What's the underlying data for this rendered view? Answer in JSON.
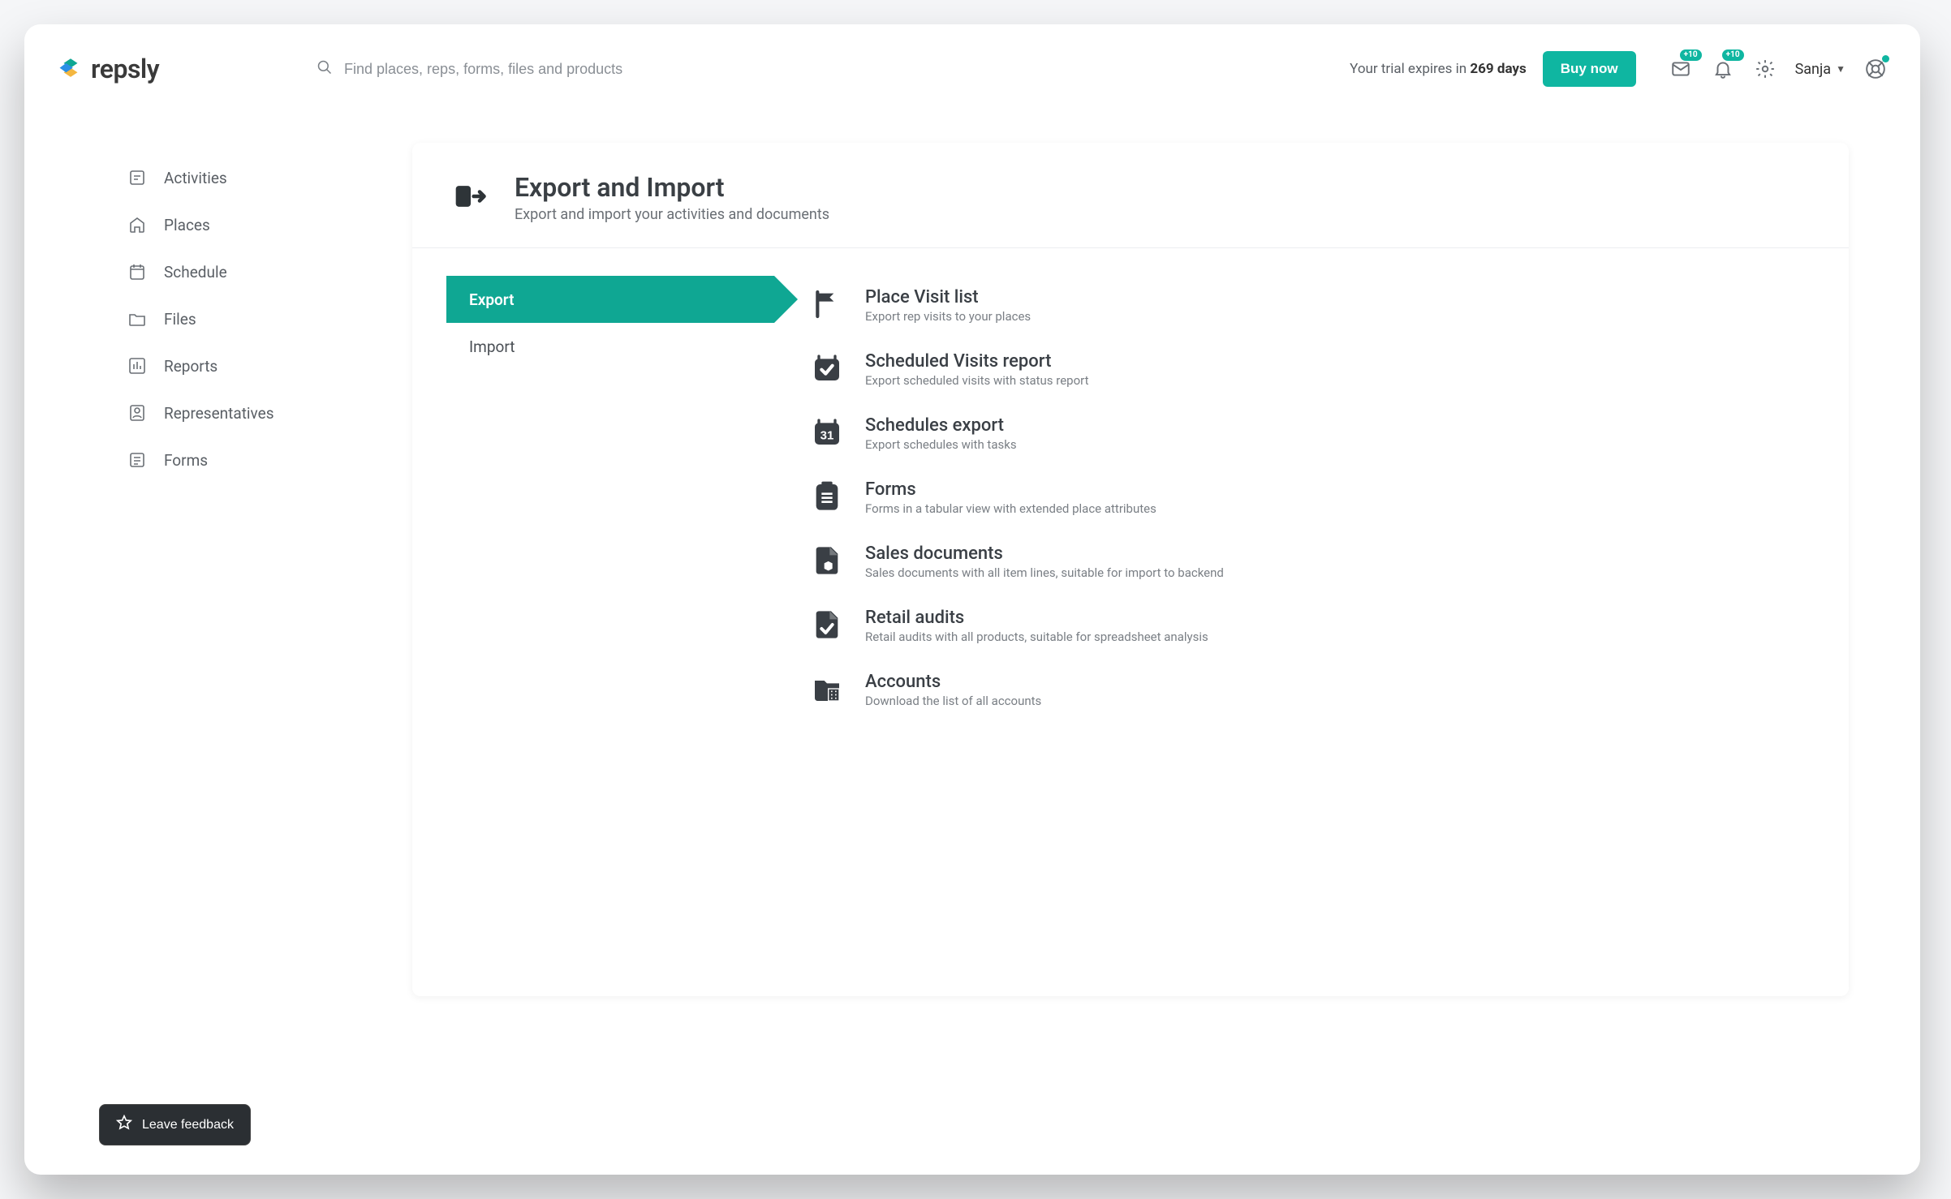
{
  "brand": {
    "name": "repsly"
  },
  "search": {
    "placeholder": "Find places, reps, forms, files and products"
  },
  "trial": {
    "prefix": "Your trial expires in ",
    "days": "269 days"
  },
  "buy": {
    "label": "Buy now"
  },
  "notifications": {
    "inbox_badge": "+10",
    "bell_badge": "+10"
  },
  "user": {
    "name": "Sanja"
  },
  "sidebar": {
    "items": [
      {
        "label": "Activities"
      },
      {
        "label": "Places"
      },
      {
        "label": "Schedule"
      },
      {
        "label": "Files"
      },
      {
        "label": "Reports"
      },
      {
        "label": "Representatives"
      },
      {
        "label": "Forms"
      }
    ]
  },
  "page": {
    "title": "Export and Import",
    "subtitle": "Export and import your activities and documents",
    "tabs": [
      {
        "label": "Export",
        "active": true
      },
      {
        "label": "Import",
        "active": false
      }
    ],
    "options": [
      {
        "title": "Place Visit list",
        "desc": "Export rep visits to your places"
      },
      {
        "title": "Scheduled Visits report",
        "desc": "Export scheduled visits with status report"
      },
      {
        "title": "Schedules export",
        "desc": "Export schedules with tasks"
      },
      {
        "title": "Forms",
        "desc": "Forms in a tabular view with extended place attributes"
      },
      {
        "title": "Sales documents",
        "desc": "Sales documents with all item lines, suitable for import to backend"
      },
      {
        "title": "Retail audits",
        "desc": "Retail audits with all products, suitable for spreadsheet analysis"
      },
      {
        "title": "Accounts",
        "desc": "Download the list of all accounts"
      }
    ]
  },
  "feedback": {
    "label": "Leave feedback"
  }
}
